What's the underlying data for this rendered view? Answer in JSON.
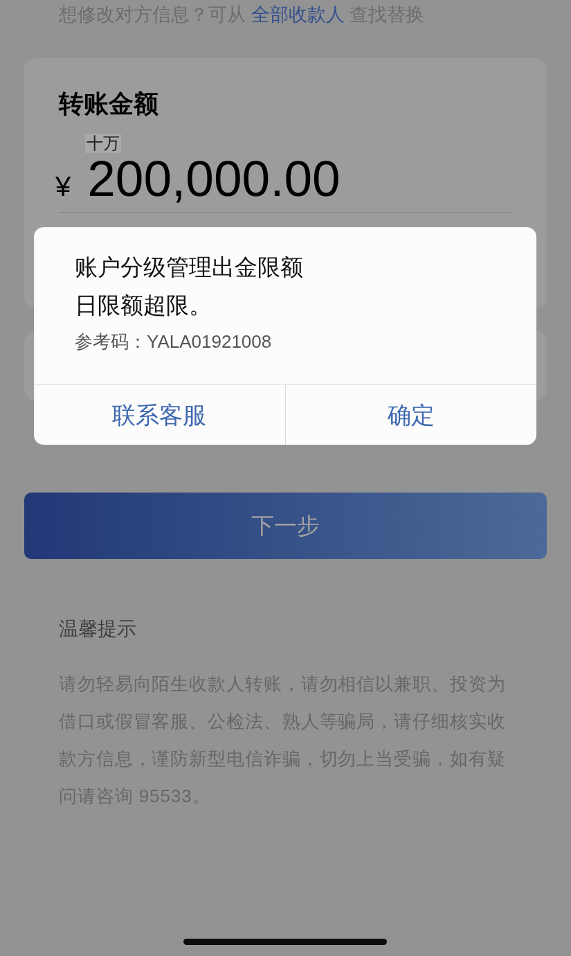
{
  "hint": {
    "text_before": "想修改对方信息？可从",
    "link": "全部收款人",
    "text_after": "查找替换"
  },
  "amount_card": {
    "title": "转账金额",
    "unit_hint": "十万",
    "currency": "¥",
    "amount": "200,000.00"
  },
  "next_button": {
    "label": "下一步"
  },
  "tips": {
    "title": "温馨提示",
    "body": "请勿轻易向陌生收款人转账，请勿相信以兼职、投资为借口或假冒客服、公检法、熟人等骗局，请仔细核实收款方信息，谨防新型电信诈骗，切勿上当受骗，如有疑问请咨询 95533。"
  },
  "dialog": {
    "message_lines": [
      "账户分级管理出金限额",
      "日限额超限。"
    ],
    "reference": "参考码：YALA01921008",
    "buttons": [
      "联系客服",
      "确定"
    ]
  }
}
